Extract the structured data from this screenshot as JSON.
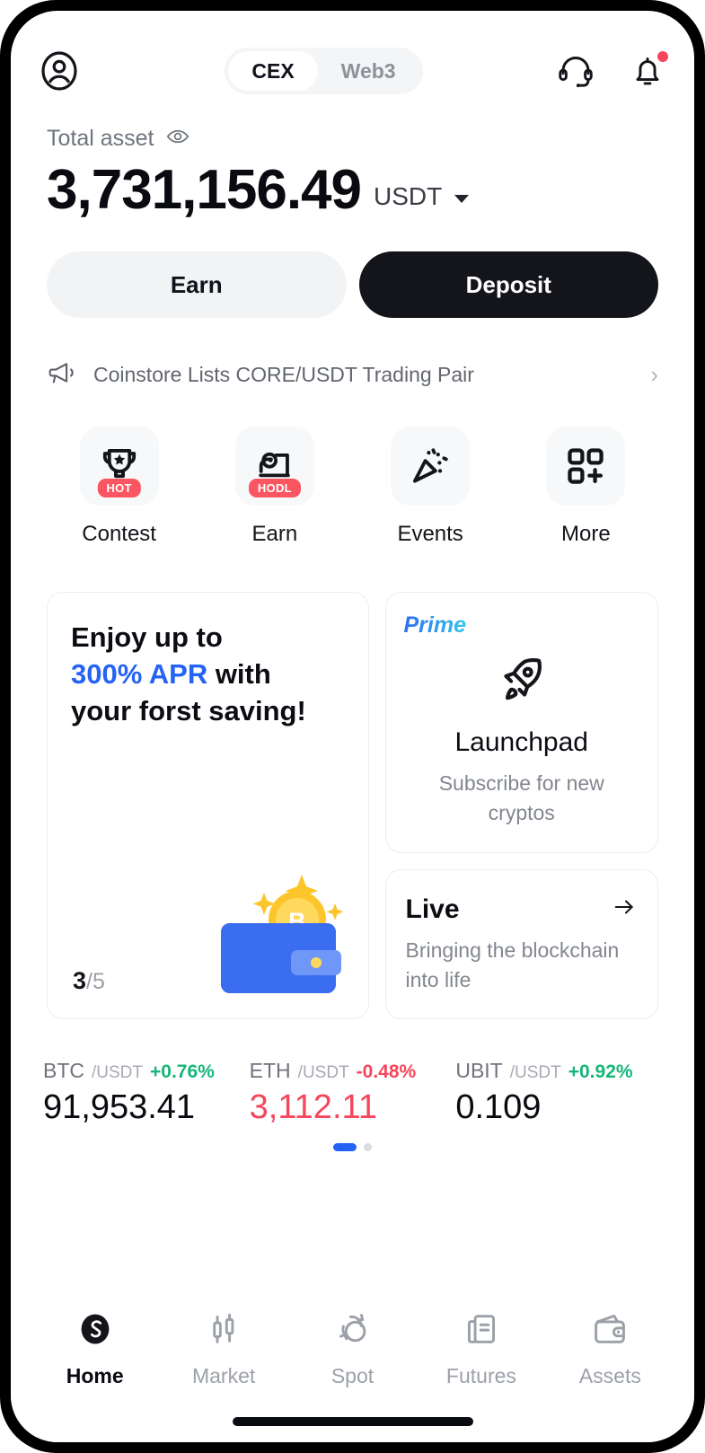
{
  "header": {
    "avatar_icon": "user-circle-icon",
    "tabs": [
      {
        "label": "CEX",
        "active": true
      },
      {
        "label": "Web3",
        "active": false
      }
    ],
    "support_icon": "headset-icon",
    "notification_icon": "bell-icon",
    "notification_has_badge": true
  },
  "balance": {
    "label": "Total asset",
    "eye_icon": "eye-icon",
    "amount": "3,731,156.49",
    "currency": "USDT",
    "currency_caret": "chevron-down-icon"
  },
  "actions": {
    "earn_label": "Earn",
    "deposit_label": "Deposit"
  },
  "announcement": {
    "megaphone_icon": "megaphone-icon",
    "text": "Coinstore Lists CORE/USDT Trading Pair",
    "chevron": "›"
  },
  "quick_actions": [
    {
      "label": "Contest",
      "icon": "trophy-icon",
      "badge": "HOT"
    },
    {
      "label": "Earn",
      "icon": "piggy-chart-icon",
      "badge": "HODL"
    },
    {
      "label": "Events",
      "icon": "confetti-icon",
      "badge": ""
    },
    {
      "label": "More",
      "icon": "grid-plus-icon",
      "badge": ""
    }
  ],
  "promo_saving": {
    "line1": "Enjoy up to",
    "highlight": "300% APR",
    "line2_rest": " with",
    "line3": "your forst saving!",
    "art_icon": "wallet-bitcoin-icon",
    "counter_current": "3",
    "counter_total": "/5"
  },
  "promo_prime": {
    "tag": "Prime",
    "icon": "rocket-icon",
    "title": "Launchpad",
    "subtitle": "Subscribe for new cryptos"
  },
  "promo_live": {
    "title": "Live",
    "arrow_icon": "arrow-right-icon",
    "subtitle": "Bringing the blockchain into life"
  },
  "tickers": [
    {
      "base": "BTC",
      "quote": "/USDT",
      "change": "+0.76%",
      "direction": "up",
      "price": "91,953.41",
      "price_direction": "neutral"
    },
    {
      "base": "ETH",
      "quote": "/USDT",
      "change": "-0.48%",
      "direction": "down",
      "price": "3,112.11",
      "price_direction": "down"
    },
    {
      "base": "UBIT",
      "quote": "/USDT",
      "change": "+0.92%",
      "direction": "up",
      "price": "0.109",
      "price_direction": "neutral"
    }
  ],
  "carousel": {
    "total": 2,
    "active_index": 0
  },
  "bottom_nav": [
    {
      "label": "Home",
      "icon": "logo-s-icon",
      "active": true
    },
    {
      "label": "Market",
      "icon": "candlestick-icon",
      "active": false
    },
    {
      "label": "Spot",
      "icon": "swap-circles-icon",
      "active": false
    },
    {
      "label": "Futures",
      "icon": "document-icon",
      "active": false
    },
    {
      "label": "Assets",
      "icon": "wallet-icon",
      "active": false
    }
  ],
  "colors": {
    "accent_blue": "#2563f5",
    "up_green": "#16b67a",
    "down_red": "#f6465d",
    "badge_red": "#fa5661",
    "ink": "#0a0b10"
  }
}
